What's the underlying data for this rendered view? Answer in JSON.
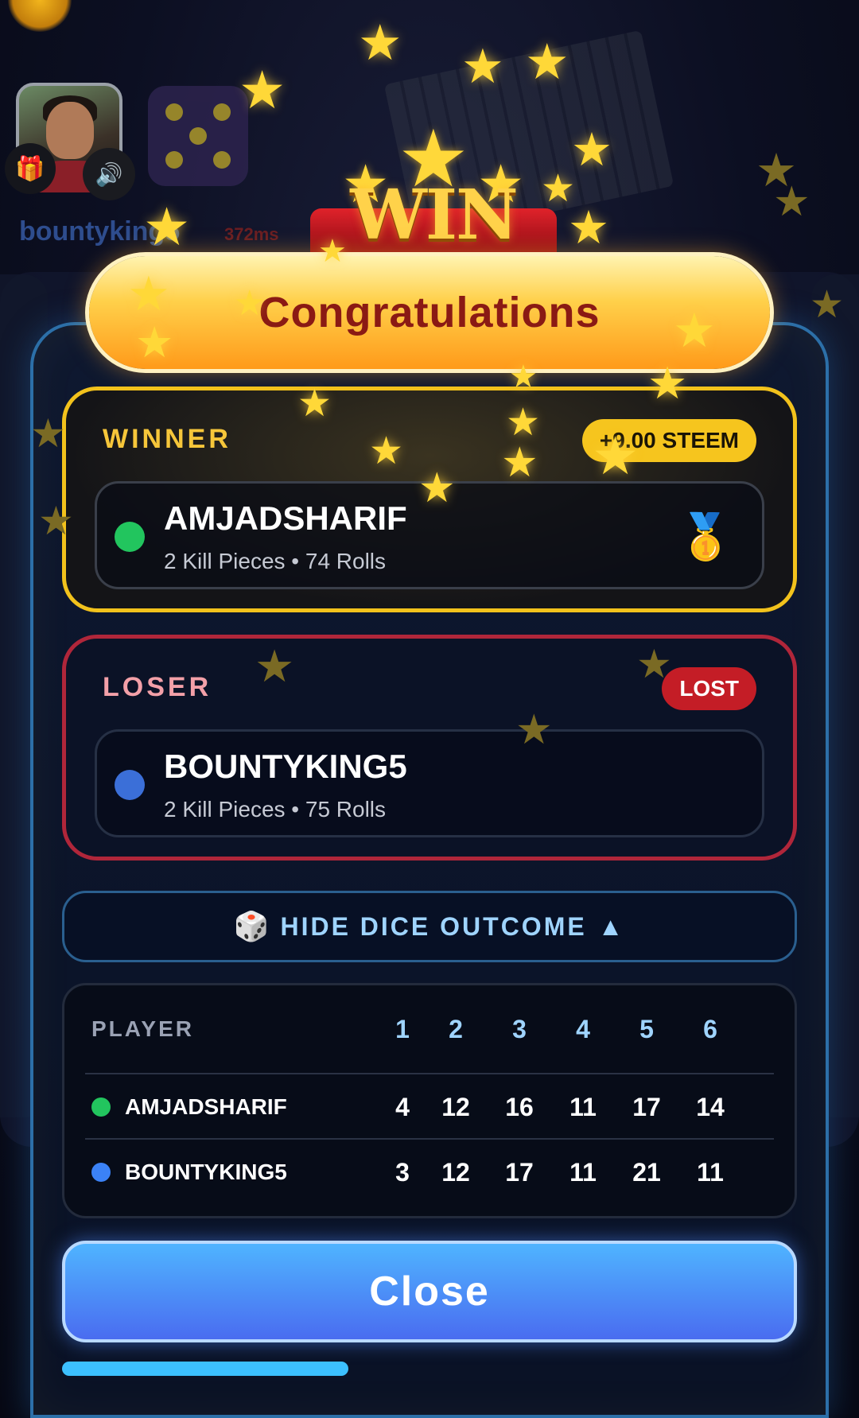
{
  "background": {
    "username": "bountyking5",
    "ping": "372ms"
  },
  "modal": {
    "emblem_text": "WIN",
    "banner": "Congratulations",
    "winner": {
      "title": "WINNER",
      "reward": "+9.00 STEEM",
      "name": "AMJADSHARIF",
      "stats": "2 Kill Pieces • 74 Rolls",
      "dot_color": "#22c55e",
      "medal_icon": "medal-icon"
    },
    "loser": {
      "title": "LOSER",
      "status": "LOST",
      "name": "BOUNTYKING5",
      "stats": "2 Kill Pieces • 75 Rolls",
      "dot_color": "#3b6fd8"
    },
    "dice_toggle": {
      "label": "HIDE DICE OUTCOME",
      "arrow": "▲",
      "icon": "dice-icon"
    },
    "dice_table": {
      "header": {
        "player": "PLAYER",
        "faces": [
          "1",
          "2",
          "3",
          "4",
          "5",
          "6"
        ]
      },
      "rows": [
        {
          "player": "AMJADSHARIF",
          "dot_color": "#22c55e",
          "counts": [
            "4",
            "12",
            "16",
            "11",
            "17",
            "14"
          ]
        },
        {
          "player": "BOUNTYKING5",
          "dot_color": "#3b82f6",
          "counts": [
            "3",
            "12",
            "17",
            "11",
            "21",
            "11"
          ]
        }
      ]
    },
    "close_label": "Close",
    "progress": 0.39
  },
  "colors": {
    "winner_border": "#f2c21c",
    "loser_border": "#b0263a",
    "accent_blue": "#3cc0ff"
  }
}
